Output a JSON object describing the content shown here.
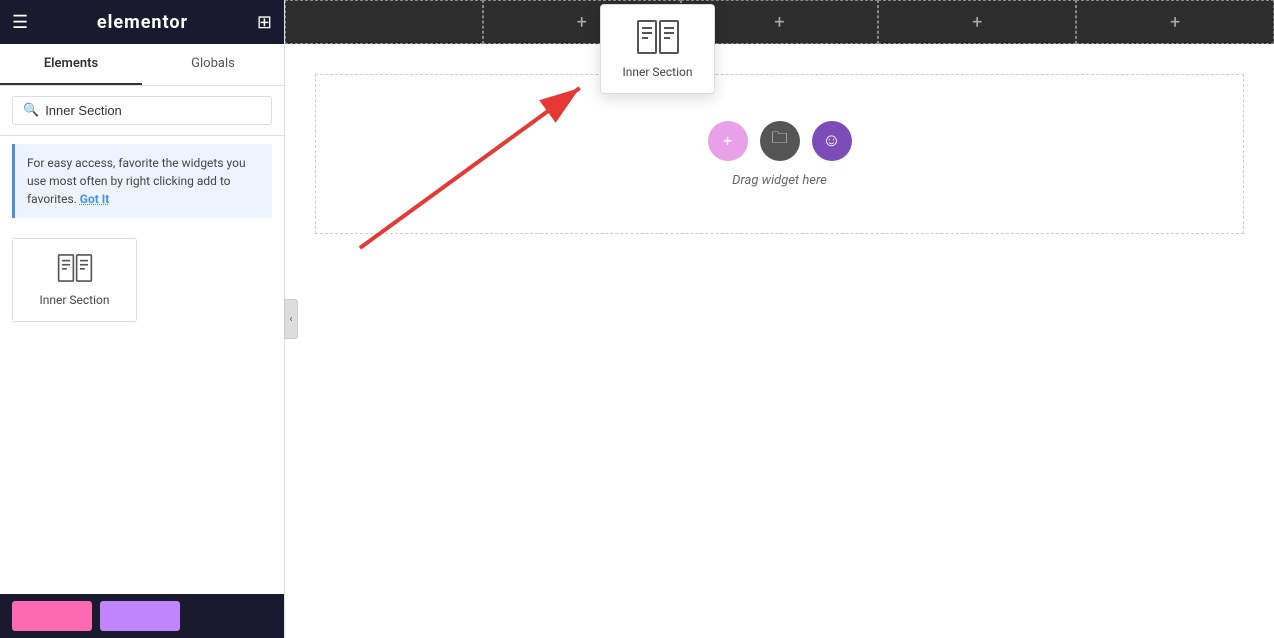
{
  "header": {
    "logo": "elementor",
    "hamburger": "☰",
    "apps": "⊞"
  },
  "sidebar": {
    "tabs": [
      {
        "label": "Elements",
        "active": true
      },
      {
        "label": "Globals",
        "active": false
      }
    ],
    "search_placeholder": "Inner Section",
    "search_value": "Inner Section",
    "tip": {
      "text": "For easy access, favorite the widgets you use most often by right clicking add to favorites.",
      "link_label": "Got It"
    },
    "widgets": [
      {
        "label": "Inner Section",
        "icon": "inner-section-icon"
      }
    ]
  },
  "canvas": {
    "sections": [
      "+",
      "+",
      "+",
      "+"
    ],
    "drag_hint": "Drag widget here",
    "popup": {
      "label": "Inner Section"
    },
    "icons": {
      "plus": "+",
      "folder": "🗀",
      "smile": "☺"
    }
  },
  "colors": {
    "active_tab_border": "#333333",
    "tip_border": "#4a90e2",
    "tip_bg": "#eef4ff",
    "arrow_red": "#e53935",
    "icon_pink": "#e8a0e8",
    "icon_dark": "#555555",
    "icon_purple": "#7c4db8"
  }
}
